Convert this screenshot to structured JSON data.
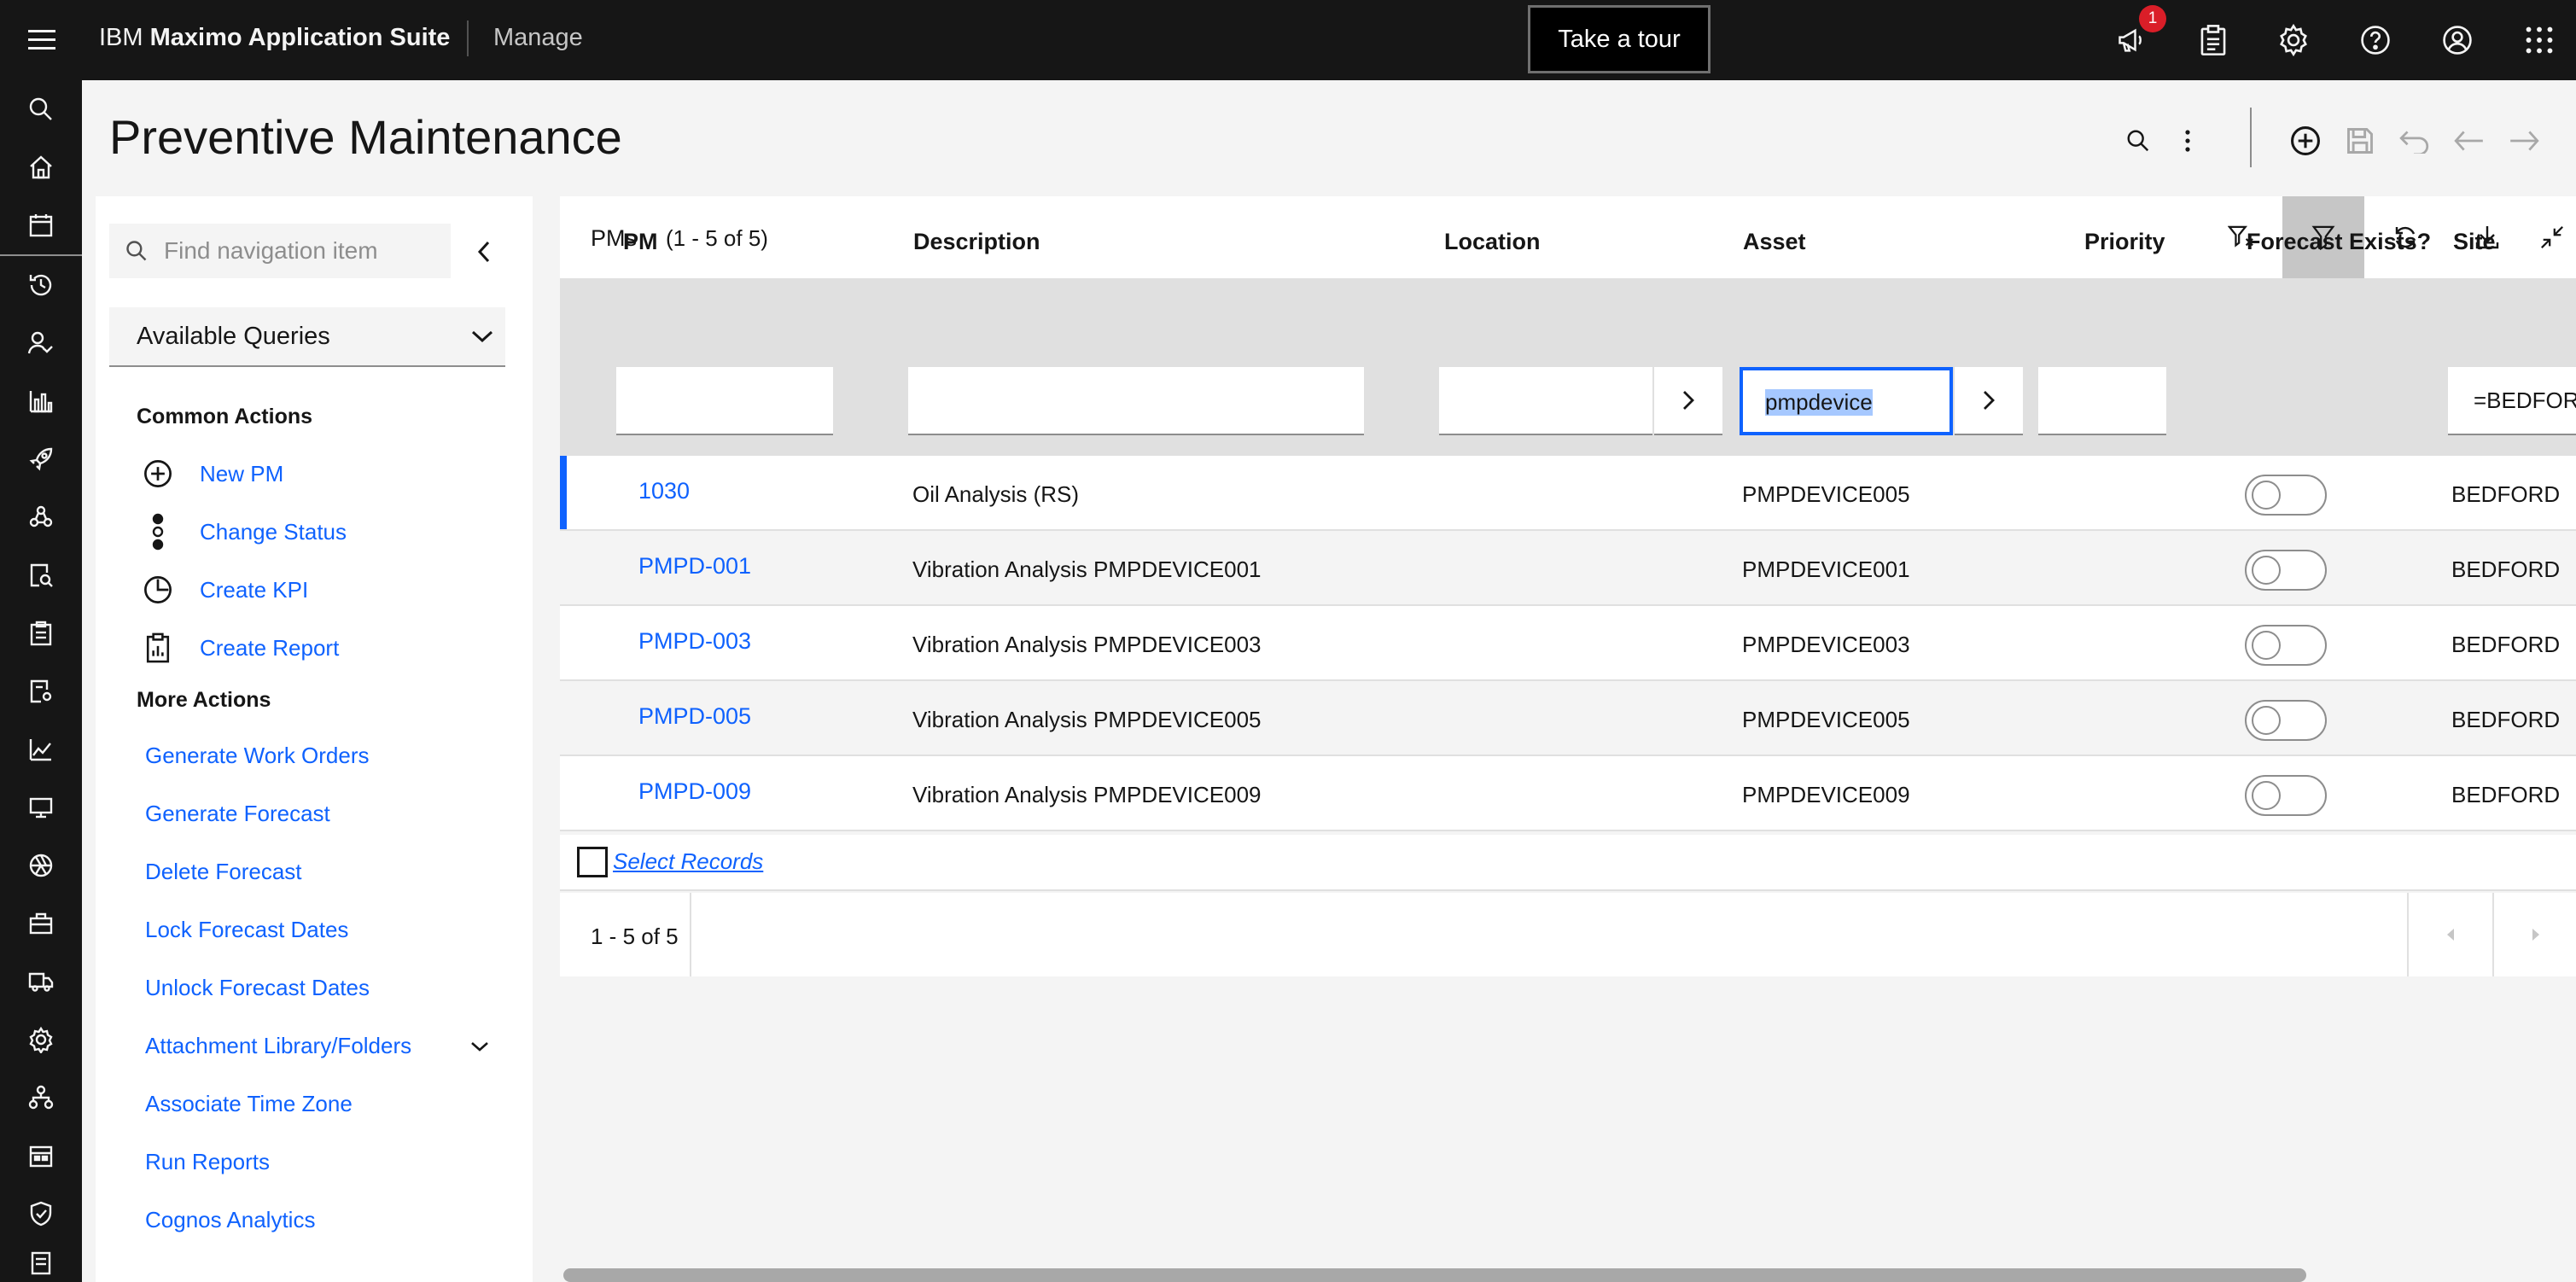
{
  "topbar": {
    "brand_prefix": "IBM",
    "brand_name": "Maximo Application Suite",
    "app_name": "Manage",
    "tour_label": "Take a tour",
    "notification_count": "1"
  },
  "page": {
    "title": "Preventive Maintenance"
  },
  "nav": {
    "search_placeholder": "Find navigation item",
    "queries_label": "Available Queries",
    "common_actions_title": "Common Actions",
    "common_actions": [
      {
        "label": "New PM",
        "icon": "add-circle-icon"
      },
      {
        "label": "Change Status",
        "icon": "status-dots-icon"
      },
      {
        "label": "Create KPI",
        "icon": "clock-pie-icon"
      },
      {
        "label": "Create Report",
        "icon": "clipboard-report-icon"
      }
    ],
    "more_actions_title": "More Actions",
    "more_actions": [
      "Generate Work Orders",
      "Generate Forecast",
      "Delete Forecast",
      "Lock Forecast Dates",
      "Unlock Forecast Dates",
      "Attachment Library/Folders",
      "Associate Time Zone",
      "Run Reports",
      "Cognos Analytics"
    ]
  },
  "table": {
    "title": "PMs",
    "count": "(1 - 5 of 5)",
    "columns": [
      "PM",
      "Description",
      "Location",
      "Asset",
      "Priority",
      "Forecast Exists?",
      "Site"
    ],
    "filters": {
      "asset": "pmpdevice",
      "site": "=BEDFORD"
    },
    "rows": [
      {
        "pm": "1030",
        "description": "Oil Analysis (RS)",
        "asset": "PMPDEVICE005",
        "forecast": false,
        "site": "BEDFORD"
      },
      {
        "pm": "PMPD-001",
        "description": "Vibration Analysis PMPDEVICE001",
        "asset": "PMPDEVICE001",
        "forecast": false,
        "site": "BEDFORD"
      },
      {
        "pm": "PMPD-003",
        "description": "Vibration Analysis PMPDEVICE003",
        "asset": "PMPDEVICE003",
        "forecast": false,
        "site": "BEDFORD"
      },
      {
        "pm": "PMPD-005",
        "description": "Vibration Analysis PMPDEVICE005",
        "asset": "PMPDEVICE005",
        "forecast": false,
        "site": "BEDFORD"
      },
      {
        "pm": "PMPD-009",
        "description": "Vibration Analysis PMPDEVICE009",
        "asset": "PMPDEVICE009",
        "forecast": false,
        "site": "BEDFORD"
      }
    ],
    "select_records_label": "Select Records",
    "pager_label": "1 - 5 of 5"
  },
  "colors": {
    "accent": "#0f62fe",
    "topbar": "#161616",
    "badge": "#da1e28"
  }
}
